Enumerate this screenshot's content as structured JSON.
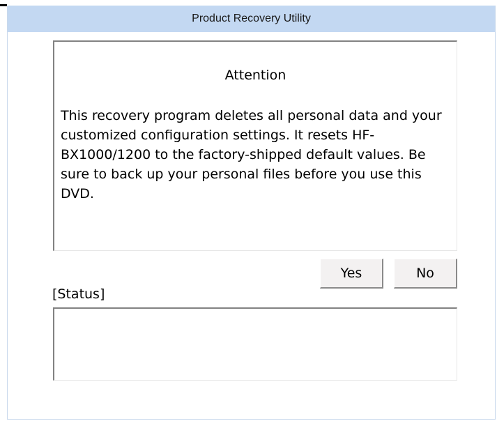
{
  "window": {
    "title": "Product Recovery Utility"
  },
  "message": {
    "heading": "Attention",
    "body": "This recovery program deletes all personal data and your customized configuration settings. It resets HF-BX1000/1200 to the factory-shipped default values. Be sure to back up your personal files before you use this DVD."
  },
  "buttons": {
    "yes_label": "Yes",
    "no_label": "No"
  },
  "status": {
    "label": "[Status]",
    "value": ""
  },
  "colors": {
    "titlebar": "#c3d8f2",
    "window_border": "#c9d9ec",
    "button_face": "#f3f1f1",
    "inset_border": "#828282"
  }
}
